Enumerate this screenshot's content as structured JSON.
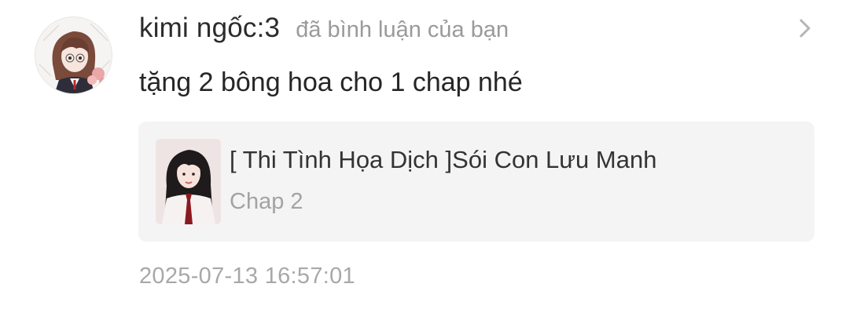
{
  "notification": {
    "username": "kimi ngốc:3",
    "action": "đã bình luận của bạn",
    "comment": "tặng 2 bông hoa cho 1 chap nhé",
    "card": {
      "title": "[ Thi Tình Họa Dịch ]Sói Con Lưu Manh",
      "subtitle": "Chap 2"
    },
    "timestamp": "2025-07-13 16:57:01",
    "icons": {
      "chevron": "chevron-right-icon",
      "avatar": "user-avatar",
      "thumbnail": "story-cover-thumbnail"
    },
    "colors": {
      "username": "#2b2b2b",
      "secondary_text": "#9a9a9a",
      "card_background": "#f4f4f5"
    }
  }
}
